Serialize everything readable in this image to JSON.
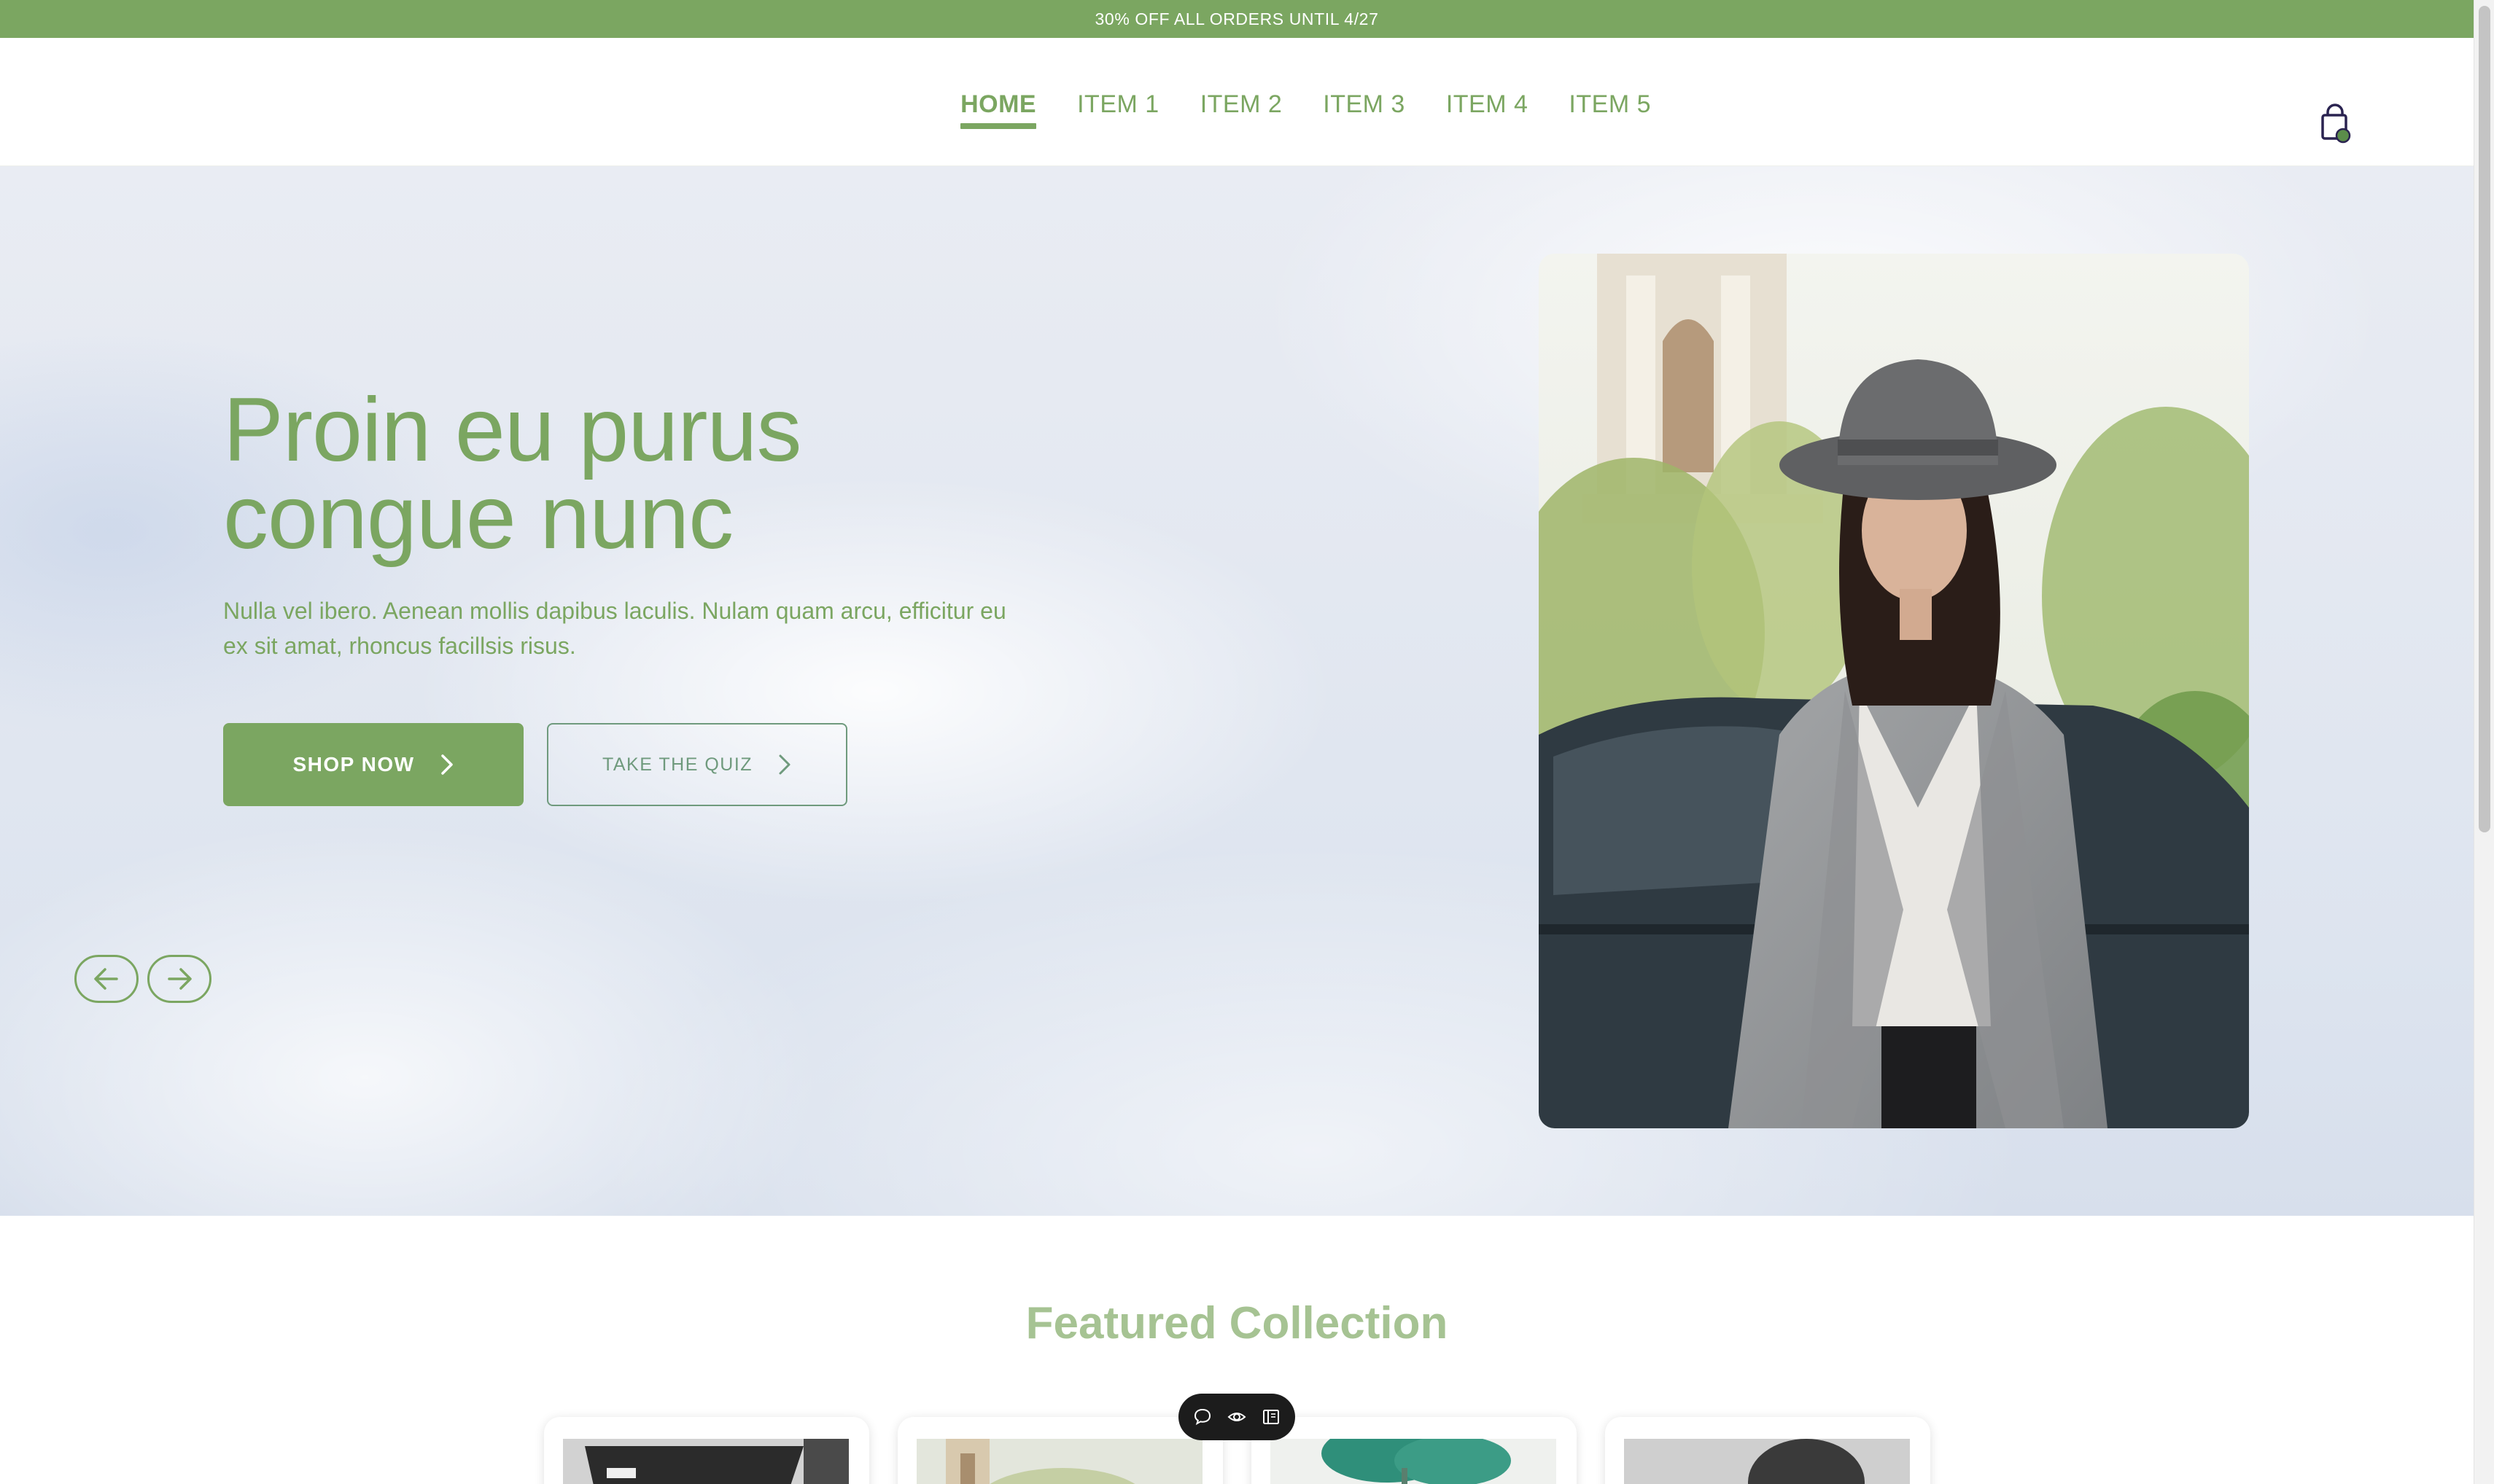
{
  "announcement": "30% OFF ALL ORDERS UNTIL 4/27",
  "nav": {
    "home": "HOME",
    "item1": "ITEM 1",
    "item2": "ITEM 2",
    "item3": "ITEM 3",
    "item4": "ITEM 4",
    "item5": "ITEM 5"
  },
  "cart": {
    "icon": "shopping-bag-icon",
    "badge_color": "#5b8d4a"
  },
  "hero": {
    "title_line1": "Proin eu purus",
    "title_line2": "congue nunc",
    "subtitle_line1": "Nulla vel ibero. Aenean mollis dapibus laculis. Nulam quam arcu, efficitur eu",
    "subtitle_line2": "ex sit amat, rhoncus facillsis risus.",
    "primary_button": "SHOP NOW",
    "secondary_button": "TAKE THE QUIZ",
    "prev_icon": "arrow-left-icon",
    "next_icon": "arrow-right-icon"
  },
  "featured": {
    "title": "Featured Collection"
  },
  "toolbar": {
    "icons": [
      "comment-icon",
      "eye-icon",
      "book-icon"
    ]
  },
  "colors": {
    "accent": "#7ba661",
    "secondary": "#6f9a7d",
    "featured_title": "#a6c393"
  }
}
